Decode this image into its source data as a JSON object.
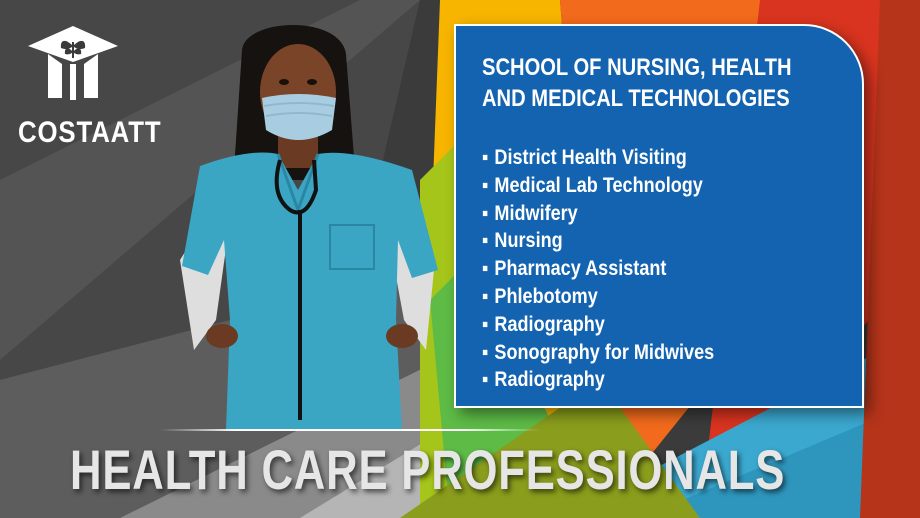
{
  "brand": {
    "logo_text": "COSTAATT",
    "logo_icon": "graduation-cap-plant-icon"
  },
  "panel": {
    "title_line1": "SCHOOL OF NURSING, HEALTH",
    "title_line2": "AND MEDICAL TECHNOLOGIES",
    "bullet": "▪",
    "programs": [
      "District Health Visiting",
      "Medical Lab Technology",
      "Midwifery",
      "Nursing",
      "Pharmacy Assistant",
      "Phlebotomy",
      "Radiography",
      "Sonography for Midwives",
      "Radiography"
    ]
  },
  "headline": "HEALTH CARE PROFESSIONALS",
  "colors": {
    "panel_blue": "#1363b0",
    "scrub_teal": "#3aa6c4",
    "yellow": "#f7b500",
    "orange": "#f26a1b",
    "red": "#d9341f",
    "lime": "#a6c51a",
    "sky": "#3ba8cf"
  }
}
